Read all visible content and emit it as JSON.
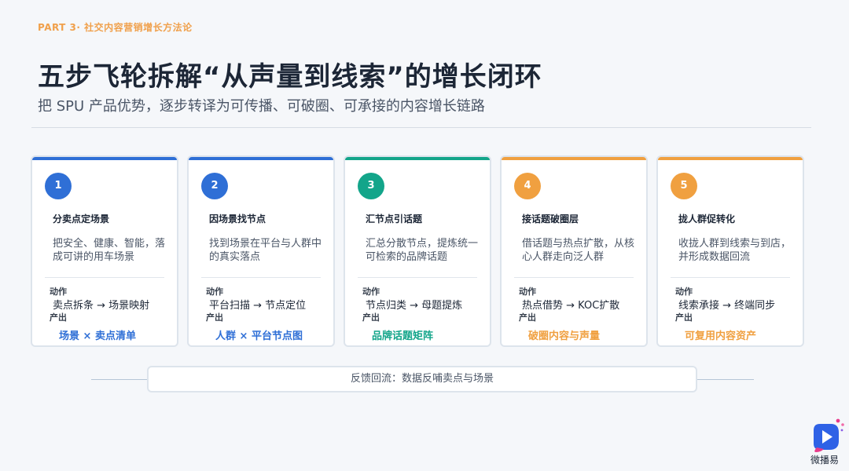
{
  "header": {
    "part": "PART 3· 社交内容营销增长方法论",
    "title": "五步飞轮拆解“从声量到线索”的增长闭环",
    "subtitle": "把 SPU 产品优势，逐步转译为可传播、可破圈、可承接的内容增长链路"
  },
  "labels": {
    "action": "动作",
    "output": "产出"
  },
  "cards": [
    {
      "number": "1",
      "title": "分卖点定场景",
      "desc": "把安全、健康、智能，落成可讲的用车场景",
      "action": "卖点拆条 → 场景映射",
      "output": "场景 × 卖点清单",
      "accent": "#2f6fd6"
    },
    {
      "number": "2",
      "title": "因场景找节点",
      "desc": "找到场景在平台与人群中的真实落点",
      "action": "平台扫描 → 节点定位",
      "output": "人群 × 平台节点图",
      "accent": "#2f6fd6"
    },
    {
      "number": "3",
      "title": "汇节点引话题",
      "desc": "汇总分散节点，提炼统一可检索的品牌话题",
      "action": "节点归类 → 母题提炼",
      "output": "品牌话题矩阵",
      "accent": "#13a58a"
    },
    {
      "number": "4",
      "title": "接话题破圈层",
      "desc": "借话题与热点扩散，从核心人群走向泛人群",
      "action": "热点借势 → KOC扩散",
      "output": "破圈内容与声量",
      "accent": "#f0a040"
    },
    {
      "number": "5",
      "title": "拢人群促转化",
      "desc": "收拢人群到线索与到店，并形成数据回流",
      "action": "线索承接 → 终端同步",
      "output": "可复用内容资产",
      "accent": "#f0a040"
    }
  ],
  "feedback": "反馈回流：数据反哺卖点与场景",
  "brand": {
    "name": "微播易"
  }
}
